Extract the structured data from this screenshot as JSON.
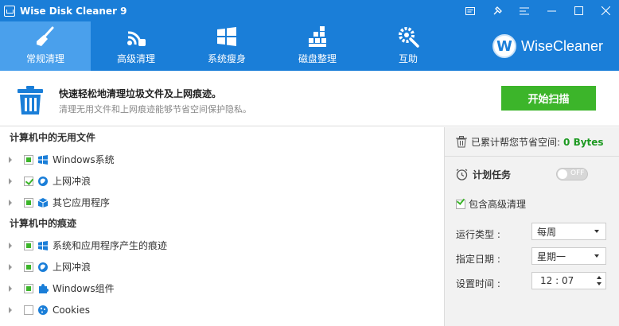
{
  "app": {
    "title": "Wise Disk Cleaner 9"
  },
  "titlebar_buttons": [
    "feedback-icon",
    "skin-icon",
    "menu-icon",
    "minimize-icon",
    "maximize-icon",
    "close-icon"
  ],
  "toolbar": {
    "tabs": [
      {
        "label": "常规清理",
        "icon": "broom-icon"
      },
      {
        "label": "高级清理",
        "icon": "advanced-clean-icon"
      },
      {
        "label": "系统瘦身",
        "icon": "windows-icon"
      },
      {
        "label": "磁盘整理",
        "icon": "defrag-icon"
      },
      {
        "label": "互助",
        "icon": "gear-icon"
      }
    ],
    "brand": "WiseCleaner",
    "brand_logo": "W"
  },
  "info": {
    "title": "快速轻松地清理垃圾文件及上网痕迹。",
    "description": "清理无用文件和上网痕迹能够节省空间保护隐私。",
    "scan_button": "开始扫描"
  },
  "list": {
    "section1": {
      "title": "计算机中的无用文件",
      "items": [
        {
          "label": "Windows系统",
          "state": "partial",
          "icon": "windows-icon"
        },
        {
          "label": "上网冲浪",
          "state": "checked",
          "icon": "browser-icon"
        },
        {
          "label": "其它应用程序",
          "state": "partial",
          "icon": "package-icon"
        }
      ]
    },
    "section2": {
      "title": "计算机中的痕迹",
      "items": [
        {
          "label": "系统和应用程序产生的痕迹",
          "state": "partial",
          "icon": "windows-icon"
        },
        {
          "label": "上网冲浪",
          "state": "partial",
          "icon": "browser-icon"
        },
        {
          "label": "Windows组件",
          "state": "partial",
          "icon": "puzzle-icon"
        },
        {
          "label": "Cookies",
          "state": "unchecked",
          "icon": "cookie-icon"
        }
      ]
    }
  },
  "panel": {
    "saved_label": "已累计帮您节省空间:",
    "saved_value": "0 Bytes",
    "schedule_label": "计划任务",
    "toggle_text": "OFF",
    "include_advanced": "包含高级清理",
    "run_type_label": "运行类型 :",
    "run_type_value": "每周",
    "date_label": "指定日期 :",
    "date_value": "星期一",
    "time_label": "设置时间 :",
    "time_value": "12 : 07"
  },
  "colors": {
    "primary": "#1a7ed8",
    "active_tab": "#4aa0ec",
    "scan": "#3cb52a",
    "saved_value": "#1e9a22"
  }
}
